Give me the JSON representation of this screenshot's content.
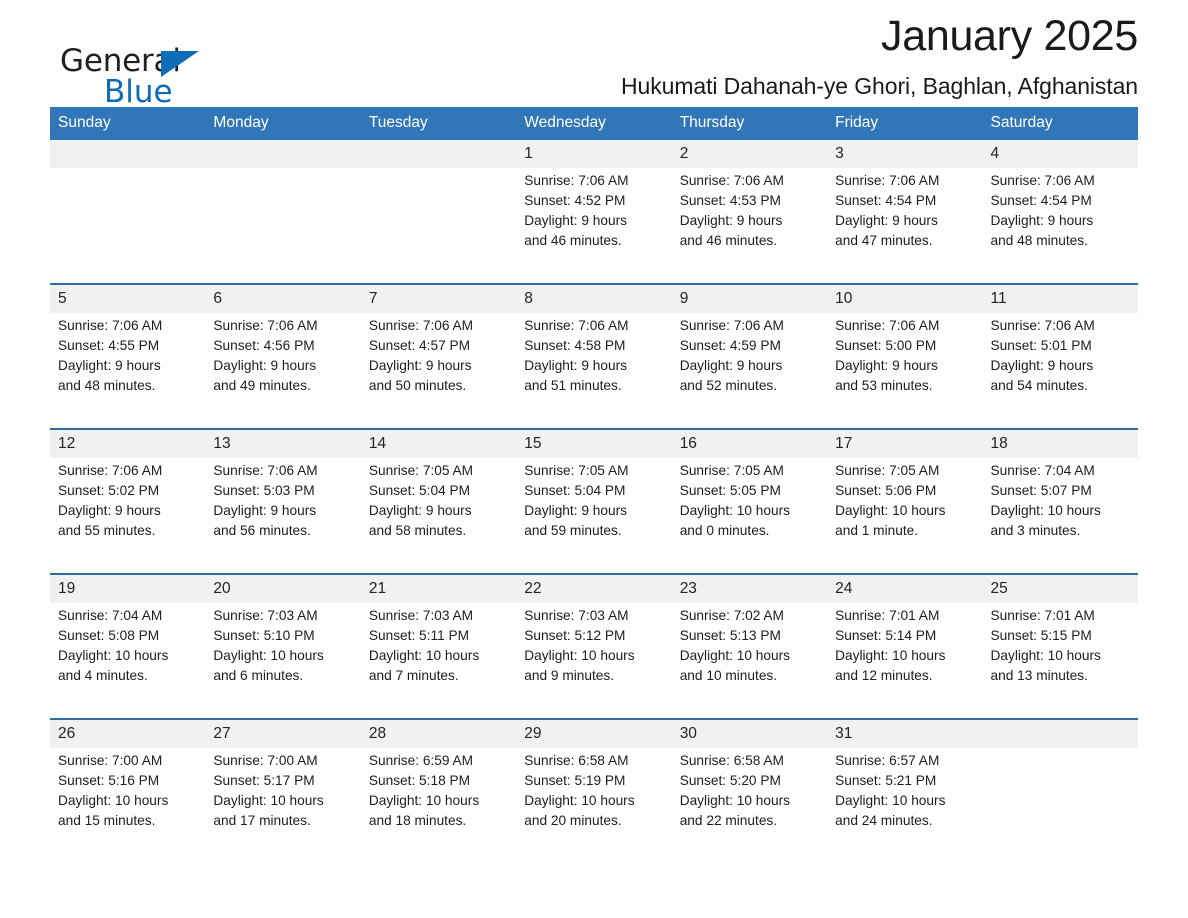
{
  "brand": {
    "word1": "General",
    "word2": "Blue",
    "triangle_color": "#0f6cb6"
  },
  "header": {
    "month_title": "January 2025",
    "location": "Hukumati Dahanah-ye Ghori, Baghlan, Afghanistan",
    "header_bg_color": "#3176b8",
    "daynum_bg_color": "#f1f1f1",
    "week_rule_color": "#2e6da4"
  },
  "weekday_headers": [
    "Sunday",
    "Monday",
    "Tuesday",
    "Wednesday",
    "Thursday",
    "Friday",
    "Saturday"
  ],
  "weeks": [
    {
      "days": [
        {
          "num": "",
          "sunrise": "",
          "sunset": "",
          "daylight1": "",
          "daylight2": "",
          "empty": true
        },
        {
          "num": "",
          "sunrise": "",
          "sunset": "",
          "daylight1": "",
          "daylight2": "",
          "empty": true
        },
        {
          "num": "",
          "sunrise": "",
          "sunset": "",
          "daylight1": "",
          "daylight2": "",
          "empty": true
        },
        {
          "num": "1",
          "sunrise": "Sunrise: 7:06 AM",
          "sunset": "Sunset: 4:52 PM",
          "daylight1": "Daylight: 9 hours",
          "daylight2": "and 46 minutes.",
          "empty": false
        },
        {
          "num": "2",
          "sunrise": "Sunrise: 7:06 AM",
          "sunset": "Sunset: 4:53 PM",
          "daylight1": "Daylight: 9 hours",
          "daylight2": "and 46 minutes.",
          "empty": false
        },
        {
          "num": "3",
          "sunrise": "Sunrise: 7:06 AM",
          "sunset": "Sunset: 4:54 PM",
          "daylight1": "Daylight: 9 hours",
          "daylight2": "and 47 minutes.",
          "empty": false
        },
        {
          "num": "4",
          "sunrise": "Sunrise: 7:06 AM",
          "sunset": "Sunset: 4:54 PM",
          "daylight1": "Daylight: 9 hours",
          "daylight2": "and 48 minutes.",
          "empty": false
        }
      ]
    },
    {
      "days": [
        {
          "num": "5",
          "sunrise": "Sunrise: 7:06 AM",
          "sunset": "Sunset: 4:55 PM",
          "daylight1": "Daylight: 9 hours",
          "daylight2": "and 48 minutes.",
          "empty": false
        },
        {
          "num": "6",
          "sunrise": "Sunrise: 7:06 AM",
          "sunset": "Sunset: 4:56 PM",
          "daylight1": "Daylight: 9 hours",
          "daylight2": "and 49 minutes.",
          "empty": false
        },
        {
          "num": "7",
          "sunrise": "Sunrise: 7:06 AM",
          "sunset": "Sunset: 4:57 PM",
          "daylight1": "Daylight: 9 hours",
          "daylight2": "and 50 minutes.",
          "empty": false
        },
        {
          "num": "8",
          "sunrise": "Sunrise: 7:06 AM",
          "sunset": "Sunset: 4:58 PM",
          "daylight1": "Daylight: 9 hours",
          "daylight2": "and 51 minutes.",
          "empty": false
        },
        {
          "num": "9",
          "sunrise": "Sunrise: 7:06 AM",
          "sunset": "Sunset: 4:59 PM",
          "daylight1": "Daylight: 9 hours",
          "daylight2": "and 52 minutes.",
          "empty": false
        },
        {
          "num": "10",
          "sunrise": "Sunrise: 7:06 AM",
          "sunset": "Sunset: 5:00 PM",
          "daylight1": "Daylight: 9 hours",
          "daylight2": "and 53 minutes.",
          "empty": false
        },
        {
          "num": "11",
          "sunrise": "Sunrise: 7:06 AM",
          "sunset": "Sunset: 5:01 PM",
          "daylight1": "Daylight: 9 hours",
          "daylight2": "and 54 minutes.",
          "empty": false
        }
      ]
    },
    {
      "days": [
        {
          "num": "12",
          "sunrise": "Sunrise: 7:06 AM",
          "sunset": "Sunset: 5:02 PM",
          "daylight1": "Daylight: 9 hours",
          "daylight2": "and 55 minutes.",
          "empty": false
        },
        {
          "num": "13",
          "sunrise": "Sunrise: 7:06 AM",
          "sunset": "Sunset: 5:03 PM",
          "daylight1": "Daylight: 9 hours",
          "daylight2": "and 56 minutes.",
          "empty": false
        },
        {
          "num": "14",
          "sunrise": "Sunrise: 7:05 AM",
          "sunset": "Sunset: 5:04 PM",
          "daylight1": "Daylight: 9 hours",
          "daylight2": "and 58 minutes.",
          "empty": false
        },
        {
          "num": "15",
          "sunrise": "Sunrise: 7:05 AM",
          "sunset": "Sunset: 5:04 PM",
          "daylight1": "Daylight: 9 hours",
          "daylight2": "and 59 minutes.",
          "empty": false
        },
        {
          "num": "16",
          "sunrise": "Sunrise: 7:05 AM",
          "sunset": "Sunset: 5:05 PM",
          "daylight1": "Daylight: 10 hours",
          "daylight2": "and 0 minutes.",
          "empty": false
        },
        {
          "num": "17",
          "sunrise": "Sunrise: 7:05 AM",
          "sunset": "Sunset: 5:06 PM",
          "daylight1": "Daylight: 10 hours",
          "daylight2": "and 1 minute.",
          "empty": false
        },
        {
          "num": "18",
          "sunrise": "Sunrise: 7:04 AM",
          "sunset": "Sunset: 5:07 PM",
          "daylight1": "Daylight: 10 hours",
          "daylight2": "and 3 minutes.",
          "empty": false
        }
      ]
    },
    {
      "days": [
        {
          "num": "19",
          "sunrise": "Sunrise: 7:04 AM",
          "sunset": "Sunset: 5:08 PM",
          "daylight1": "Daylight: 10 hours",
          "daylight2": "and 4 minutes.",
          "empty": false
        },
        {
          "num": "20",
          "sunrise": "Sunrise: 7:03 AM",
          "sunset": "Sunset: 5:10 PM",
          "daylight1": "Daylight: 10 hours",
          "daylight2": "and 6 minutes.",
          "empty": false
        },
        {
          "num": "21",
          "sunrise": "Sunrise: 7:03 AM",
          "sunset": "Sunset: 5:11 PM",
          "daylight1": "Daylight: 10 hours",
          "daylight2": "and 7 minutes.",
          "empty": false
        },
        {
          "num": "22",
          "sunrise": "Sunrise: 7:03 AM",
          "sunset": "Sunset: 5:12 PM",
          "daylight1": "Daylight: 10 hours",
          "daylight2": "and 9 minutes.",
          "empty": false
        },
        {
          "num": "23",
          "sunrise": "Sunrise: 7:02 AM",
          "sunset": "Sunset: 5:13 PM",
          "daylight1": "Daylight: 10 hours",
          "daylight2": "and 10 minutes.",
          "empty": false
        },
        {
          "num": "24",
          "sunrise": "Sunrise: 7:01 AM",
          "sunset": "Sunset: 5:14 PM",
          "daylight1": "Daylight: 10 hours",
          "daylight2": "and 12 minutes.",
          "empty": false
        },
        {
          "num": "25",
          "sunrise": "Sunrise: 7:01 AM",
          "sunset": "Sunset: 5:15 PM",
          "daylight1": "Daylight: 10 hours",
          "daylight2": "and 13 minutes.",
          "empty": false
        }
      ]
    },
    {
      "days": [
        {
          "num": "26",
          "sunrise": "Sunrise: 7:00 AM",
          "sunset": "Sunset: 5:16 PM",
          "daylight1": "Daylight: 10 hours",
          "daylight2": "and 15 minutes.",
          "empty": false
        },
        {
          "num": "27",
          "sunrise": "Sunrise: 7:00 AM",
          "sunset": "Sunset: 5:17 PM",
          "daylight1": "Daylight: 10 hours",
          "daylight2": "and 17 minutes.",
          "empty": false
        },
        {
          "num": "28",
          "sunrise": "Sunrise: 6:59 AM",
          "sunset": "Sunset: 5:18 PM",
          "daylight1": "Daylight: 10 hours",
          "daylight2": "and 18 minutes.",
          "empty": false
        },
        {
          "num": "29",
          "sunrise": "Sunrise: 6:58 AM",
          "sunset": "Sunset: 5:19 PM",
          "daylight1": "Daylight: 10 hours",
          "daylight2": "and 20 minutes.",
          "empty": false
        },
        {
          "num": "30",
          "sunrise": "Sunrise: 6:58 AM",
          "sunset": "Sunset: 5:20 PM",
          "daylight1": "Daylight: 10 hours",
          "daylight2": "and 22 minutes.",
          "empty": false
        },
        {
          "num": "31",
          "sunrise": "Sunrise: 6:57 AM",
          "sunset": "Sunset: 5:21 PM",
          "daylight1": "Daylight: 10 hours",
          "daylight2": "and 24 minutes.",
          "empty": false
        },
        {
          "num": "",
          "sunrise": "",
          "sunset": "",
          "daylight1": "",
          "daylight2": "",
          "empty": true
        }
      ]
    }
  ]
}
